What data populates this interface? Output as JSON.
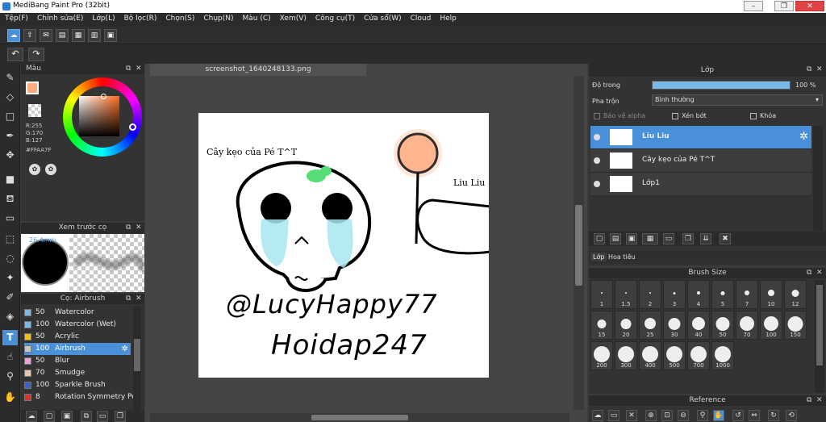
{
  "title": "MediBang Paint Pro (32bit)",
  "window_buttons": [
    "–",
    "❐",
    "✕"
  ],
  "menu": [
    "Tệp(F)",
    "Chỉnh sửa(E)",
    "Lớp(L)",
    "Bộ lọc(R)",
    "Chọn(S)",
    "Chụp(N)",
    "Màu (C)",
    "Xem(V)",
    "Công cụ(T)",
    "Cửa sổ(W)",
    "Cloud",
    "Help"
  ],
  "color_panel": {
    "title": "Màu",
    "rgb": [
      "R:255",
      "G:170",
      "B:127"
    ],
    "hex": "#FFAA7F",
    "current_color": "#ffaa7f"
  },
  "preview_panel": {
    "title": "Xem trước cọ",
    "size": "26.4mm"
  },
  "brush_panel": {
    "title": "Cọ: Airbrush",
    "items": [
      {
        "size": "50",
        "name": "Watercolor",
        "color": "#7ab8e8"
      },
      {
        "size": "100",
        "name": "Watercolor (Wet)",
        "color": "#7ab8e8"
      },
      {
        "size": "50",
        "name": "Acrylic",
        "color": "#f2c200"
      },
      {
        "size": "100",
        "name": "Airbrush",
        "color": "#c8c8c8"
      },
      {
        "size": "50",
        "name": "Blur",
        "color": "#f0a0e0"
      },
      {
        "size": "70",
        "name": "Smudge",
        "color": "#e8c8a8"
      },
      {
        "size": "100",
        "name": "Sparkle Brush",
        "color": "#3a5fd0"
      },
      {
        "size": "8",
        "name": "Rotation Symmetry Pen",
        "color": "#e03030"
      }
    ]
  },
  "document": {
    "tab": "screenshot_1640248133.png",
    "text1": "Cây kẹo của Pé T^T",
    "text2": "Liu Liu",
    "text3": "@LucyHappy77",
    "text4": "Hoidap247"
  },
  "layer_panel": {
    "title": "Lớp",
    "opacity_label": "Độ trong",
    "opacity_value": "100 %",
    "opacity_fraction": 1.0,
    "blend_label": "Pha trộn",
    "blend_value": "Bình thường",
    "protect_alpha": "Bảo vệ alpha",
    "clipping": "Xén bớt",
    "lock": "Khóa",
    "layers": [
      {
        "name": "Liu Liu",
        "selected": true
      },
      {
        "name": "Cây kẹo của Pé T^T",
        "selected": false
      },
      {
        "name": "Lớp1",
        "selected": false
      }
    ],
    "tabs": [
      "Lớp",
      "Hoa tiêu"
    ]
  },
  "brush_size": {
    "title": "Brush Size",
    "sizes": [
      "1",
      "1.5",
      "2",
      "3",
      "4",
      "5",
      "7",
      "10",
      "12",
      "15",
      "20",
      "25",
      "30",
      "40",
      "50",
      "70",
      "100",
      "150",
      "200",
      "300",
      "400",
      "500",
      "700",
      "1000"
    ]
  },
  "reference": {
    "title": "Reference"
  }
}
